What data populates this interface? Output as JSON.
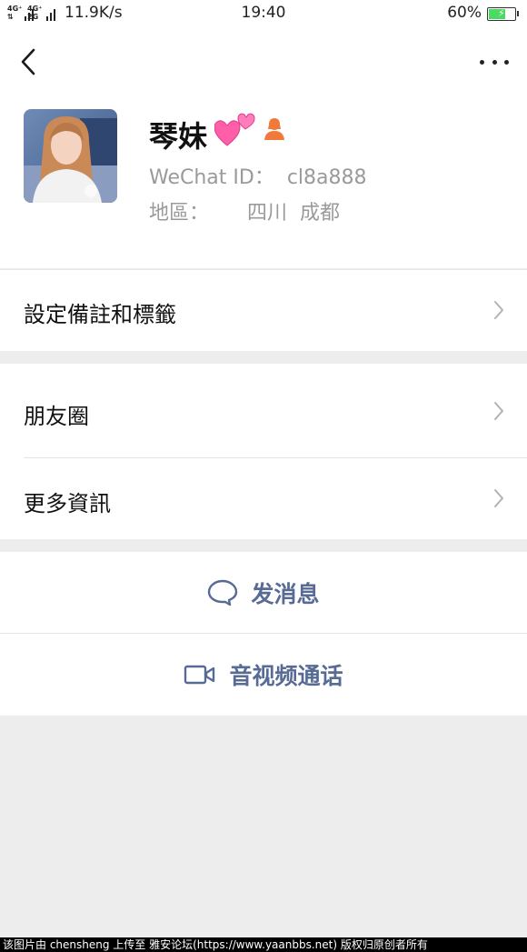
{
  "status_bar": {
    "network_1_top": "4G⁺",
    "network_1_bottom": "⇅",
    "network_2_top": "4G⁺",
    "network_2_bottom": "2G",
    "speed": "11.9K/s",
    "time": "19:40",
    "battery_percent": "60%",
    "battery_level": 0.6,
    "battery_color": "#4cd964"
  },
  "header": {
    "back_icon": "chevron-left-icon",
    "more_icon": "more-horizontal-icon"
  },
  "profile": {
    "name": "琴妹",
    "name_emoji": "two-hearts-emoji",
    "gender_icon": "female-person-icon",
    "wechat_id_line": "WeChat ID：  cl8a888",
    "region_line": "地區：      四川  成都"
  },
  "menu": {
    "remark_tags": "設定備註和標籤",
    "moments": "朋友圈",
    "more_info": "更多資訊"
  },
  "actions": {
    "send_message": "发消息",
    "video_call": "音视频通话",
    "accent_color": "#576b95"
  },
  "watermark": "该图片由 chensheng 上传至 雅安论坛(https://www.yaanbbs.net) 版权归原创者所有"
}
